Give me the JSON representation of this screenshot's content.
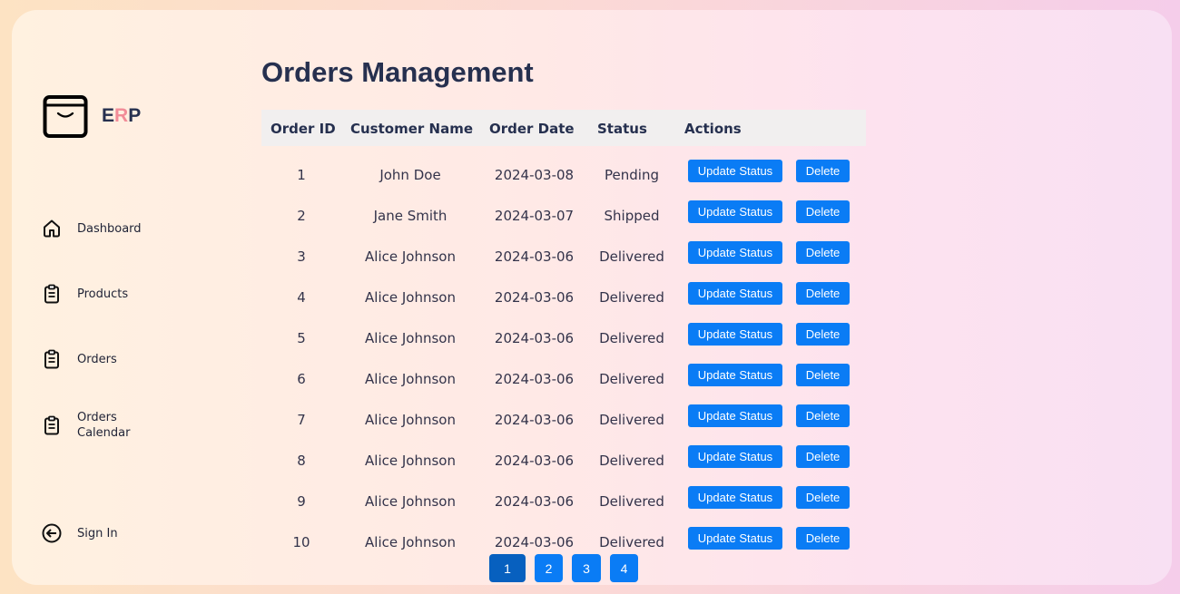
{
  "brand": {
    "prefix": "E",
    "middle": "R",
    "suffix": "P"
  },
  "nav": [
    {
      "label": "Dashboard",
      "icon": "home-icon"
    },
    {
      "label": "Products",
      "icon": "clipboard-icon"
    },
    {
      "label": "Orders",
      "icon": "clipboard-icon"
    },
    {
      "label": "Orders Calendar",
      "icon": "clipboard-icon"
    },
    {
      "label": "Sign In",
      "icon": "sign-in-icon"
    }
  ],
  "page": {
    "title": "Orders Management"
  },
  "table": {
    "headers": [
      "Order ID",
      "Customer Name",
      "Order Date",
      "Status",
      "Actions"
    ],
    "update_label": "Update Status",
    "delete_label": "Delete",
    "rows": [
      {
        "id": "1",
        "name": "John Doe",
        "date": "2024-03-08",
        "status": "Pending"
      },
      {
        "id": "2",
        "name": "Jane Smith",
        "date": "2024-03-07",
        "status": "Shipped"
      },
      {
        "id": "3",
        "name": "Alice Johnson",
        "date": "2024-03-06",
        "status": "Delivered"
      },
      {
        "id": "4",
        "name": "Alice Johnson",
        "date": "2024-03-06",
        "status": "Delivered"
      },
      {
        "id": "5",
        "name": "Alice Johnson",
        "date": "2024-03-06",
        "status": "Delivered"
      },
      {
        "id": "6",
        "name": "Alice Johnson",
        "date": "2024-03-06",
        "status": "Delivered"
      },
      {
        "id": "7",
        "name": "Alice Johnson",
        "date": "2024-03-06",
        "status": "Delivered"
      },
      {
        "id": "8",
        "name": "Alice Johnson",
        "date": "2024-03-06",
        "status": "Delivered"
      },
      {
        "id": "9",
        "name": "Alice Johnson",
        "date": "2024-03-06",
        "status": "Delivered"
      },
      {
        "id": "10",
        "name": "Alice Johnson",
        "date": "2024-03-06",
        "status": "Delivered"
      }
    ]
  },
  "pagination": {
    "pages": [
      "1",
      "2",
      "3",
      "4"
    ],
    "current": "1"
  },
  "colors": {
    "accent": "#0a7cf5",
    "active_page": "#0760bf",
    "brand_r": "#f28c98"
  }
}
